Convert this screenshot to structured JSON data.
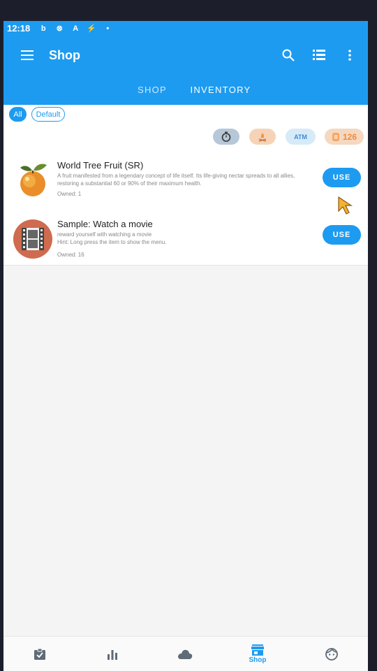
{
  "status_bar": {
    "time": "12:18",
    "icons": [
      "bing-icon",
      "blocked-circle-icon",
      "a-box-icon",
      "flash-icon",
      "dot-icon"
    ],
    "icon_glyphs": [
      "b",
      "⊗",
      "A",
      "⚡",
      "•"
    ]
  },
  "app_bar": {
    "title": "Shop",
    "actions": [
      "search-icon",
      "list-icon",
      "more-vert-icon"
    ]
  },
  "tabs": [
    {
      "label": "SHOP",
      "selected": false
    },
    {
      "label": "INVENTORY",
      "selected": true
    }
  ],
  "category_chips": [
    {
      "label": "All",
      "selected": true
    },
    {
      "label": "Default",
      "selected": false
    }
  ],
  "filters": {
    "timer_icon": "timer-icon",
    "fire_icon": "campfire-icon",
    "atm_label": "ATM",
    "coin_count": "126"
  },
  "items": [
    {
      "name": "World Tree Fruit (SR)",
      "description": "A fruit manifested from a legendary concept of life itself. Its life-giving nectar spreads to all allies, restoring a substantial 60 or 90% of their maximum health.",
      "owned": "Owned: 1",
      "action": "USE",
      "icon": "fruit-icon"
    },
    {
      "name": "Sample: Watch a movie",
      "description": "reward yourself with watching a movie\nHint: Long press the item to show the menu.",
      "owned": "Owned: 16",
      "action": "USE",
      "icon": "film-icon"
    }
  ],
  "bottom_nav": [
    {
      "icon": "tasks-icon",
      "label": "",
      "selected": false
    },
    {
      "icon": "stats-icon",
      "label": "",
      "selected": false
    },
    {
      "icon": "cloud-icon",
      "label": "",
      "selected": false
    },
    {
      "icon": "store-icon",
      "label": "Shop",
      "selected": true
    },
    {
      "icon": "face-icon",
      "label": "",
      "selected": false
    }
  ],
  "colors": {
    "primary": "#1d9bf0",
    "background": "#f4f4f5"
  }
}
